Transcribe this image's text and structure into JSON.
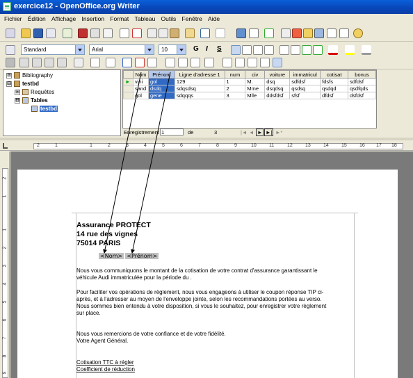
{
  "window": {
    "title": "exercice12 - OpenOffice.org Writer"
  },
  "menu": [
    "Fichier",
    "Édition",
    "Affichage",
    "Insertion",
    "Format",
    "Tableau",
    "Outils",
    "Fenêtre",
    "Aide"
  ],
  "format_toolbar": {
    "style": "Standard",
    "font": "Arial",
    "size": "10",
    "bold": "G",
    "italic": "I",
    "underline": "S"
  },
  "tree": {
    "items": [
      {
        "expander": "⊞",
        "label": "Bibliography"
      },
      {
        "expander": "⊟",
        "label": "testbd"
      },
      {
        "expander": "⊞",
        "label": "Requêtes"
      },
      {
        "expander": "⊟",
        "label": "Tables"
      },
      {
        "expander": "",
        "label": "testbd"
      }
    ]
  },
  "grid": {
    "columns": [
      "Nom",
      "Prénom",
      "Ligne d'adresse 1",
      "num",
      "civ",
      "voiture",
      "immatricul",
      "cotisat",
      "bonus"
    ],
    "rows": [
      [
        "vini",
        "gol",
        "129",
        "1",
        "M.",
        "dsq",
        "sdfdsf",
        "fdsfs",
        "sdfdsf"
      ],
      [
        "sand",
        "dsdq",
        "sdqsdsq",
        "2",
        "Mme",
        "dsqdsq",
        "qsdsq",
        "qsdqd",
        "qsdfqds"
      ],
      [
        "gol",
        "gene",
        "sdqqqs",
        "3",
        "Mlle",
        "ddsfdsf",
        "sfsf",
        "dfdsf",
        "dsfdsf"
      ]
    ],
    "record_label": "Enregistrement",
    "record_value": "1",
    "record_of": "de",
    "record_total": "3"
  },
  "ruler": {
    "marks": [
      "2",
      "1",
      "1",
      "2",
      "3",
      "4",
      "5",
      "6",
      "7",
      "8",
      "9",
      "10",
      "11",
      "12",
      "13",
      "14",
      "15",
      "16",
      "17",
      "18"
    ],
    "vmarks": [
      "2",
      "1",
      "1",
      "2",
      "3",
      "4",
      "5",
      "6",
      "7",
      "8",
      "9"
    ]
  },
  "document": {
    "header_lines": [
      "Assurance PROTECT",
      "14 rue des vignes",
      "75014 PARIS"
    ],
    "field_nom": "<Nom>",
    "field_prenom": "<Prénom>",
    "para1_l1": "Nous vous communiquons le montant de la cotisation de votre contrat d'assurance garantissant le",
    "para1_l2": "véhicule Audi immatriculée pour la période du .",
    "para2_l1": "Pour faciliter vos opérations de règlement, nous vous engageons à utiliser le coupon réponse TIP ci-",
    "para2_l2": "après, et à l'adresser au moyen de l'enveloppe jointe, selon les recommandations portées au verso.",
    "para2_l3": "Nous sommes bien entendu à votre disposition, si vous le souhaitez, pour enregistrer votre règlement",
    "para2_l4": "sur place.",
    "closing_l1": "Nous vous remercions de votre confiance et de votre fidélité.",
    "closing_l2": "Votre Agent Général.",
    "cotisation_label": "Cotisation TTC à régler",
    "coef_label": "Coefficient de réduction"
  }
}
